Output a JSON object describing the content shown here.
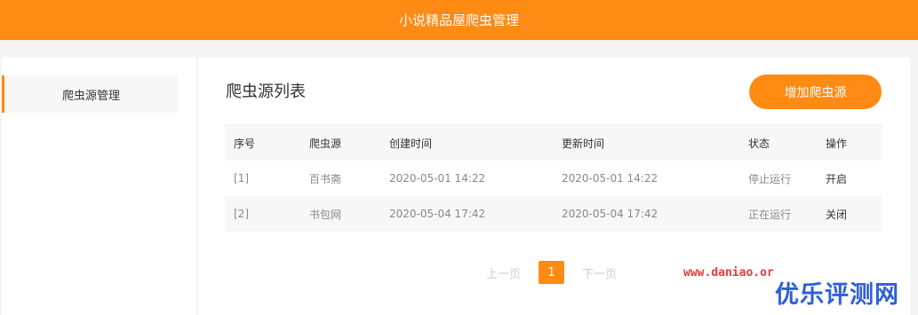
{
  "header": {
    "title": "小说精品屋爬虫管理"
  },
  "sidebar": {
    "items": [
      {
        "label": "爬虫源管理"
      }
    ]
  },
  "main": {
    "title": "爬虫源列表",
    "add_button": "增加爬虫源",
    "table": {
      "headers": [
        "序号",
        "爬虫源",
        "创建时间",
        "更新时间",
        "状态",
        "操作"
      ],
      "rows": [
        [
          "[1]",
          "百书斋",
          "2020-05-01 14:22",
          "2020-05-01 14:22",
          "停止运行",
          "开启"
        ],
        [
          "[2]",
          "书包网",
          "2020-05-04 17:42",
          "2020-05-04 17:42",
          "正在运行",
          "关闭"
        ]
      ]
    },
    "pagination": {
      "prev": "上一页",
      "current": "1",
      "next": "下一页"
    }
  },
  "watermark": {
    "url": "www.daniao.or",
    "logo": "优乐评测网"
  },
  "colors": {
    "accent": "#ff8a14"
  }
}
